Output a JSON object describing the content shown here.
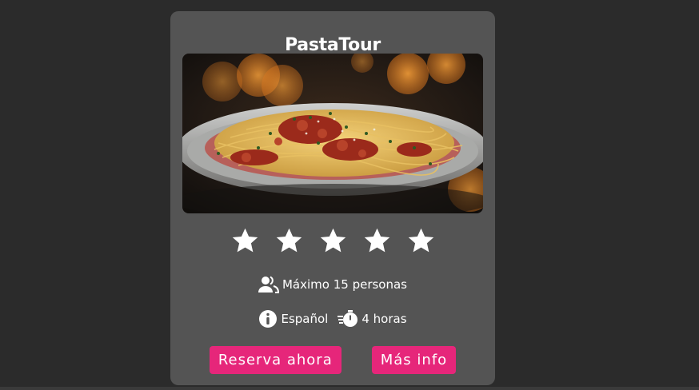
{
  "card": {
    "title": "PastaTour",
    "image_subject": "spaghetti-bolognese-photo",
    "rating": 5,
    "rating_max": 5,
    "capacity_text": "Máximo 15 personas",
    "language_text": "Español",
    "duration_text": "4 horas",
    "icons": {
      "capacity": "users-icon",
      "language": "info-icon",
      "duration": "stopwatch-icon"
    }
  },
  "actions": {
    "reserve_label": "Reserva ahora",
    "more_label": "Más info"
  },
  "colors": {
    "background": "#2b2b2b",
    "card": "#545454",
    "accent": "#e6267a",
    "text": "#ffffff"
  }
}
